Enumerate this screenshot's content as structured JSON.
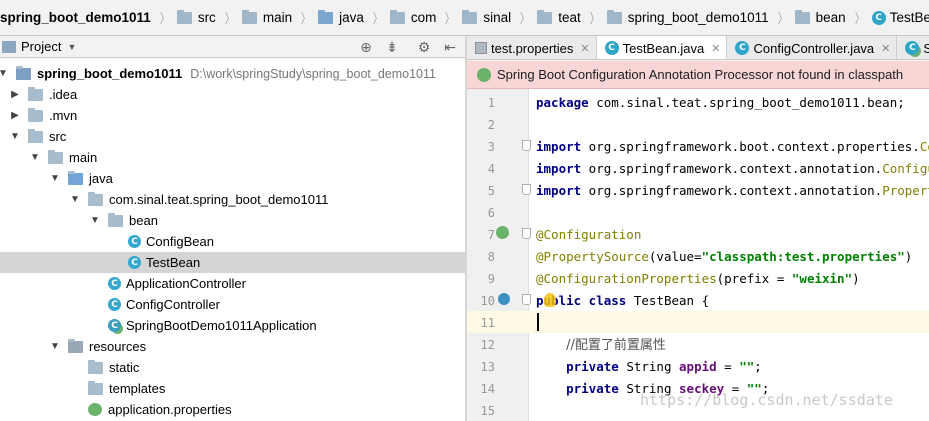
{
  "breadcrumb": [
    {
      "label": "spring_boot_demo1011",
      "icon": "module-folder-icon"
    },
    {
      "label": "src",
      "icon": "folder-icon"
    },
    {
      "label": "main",
      "icon": "folder-icon"
    },
    {
      "label": "java",
      "icon": "source-folder-icon"
    },
    {
      "label": "com",
      "icon": "folder-icon"
    },
    {
      "label": "sinal",
      "icon": "folder-icon"
    },
    {
      "label": "teat",
      "icon": "folder-icon"
    },
    {
      "label": "spring_boot_demo1011",
      "icon": "folder-icon"
    },
    {
      "label": "bean",
      "icon": "folder-icon"
    },
    {
      "label": "TestBean",
      "icon": "class-icon"
    }
  ],
  "project_panel": {
    "title": "Project",
    "tree": [
      {
        "label": "spring_boot_demo1011",
        "path": "D:\\work\\springStudy\\spring_boot_demo1011",
        "depth": 0,
        "toggle": "▼",
        "icon": "module"
      },
      {
        "label": ".idea",
        "depth": 1,
        "toggle": "▶",
        "icon": "folder"
      },
      {
        "label": ".mvn",
        "depth": 1,
        "toggle": "▶",
        "icon": "folder"
      },
      {
        "label": "src",
        "depth": 1,
        "toggle": "▼",
        "icon": "folder"
      },
      {
        "label": "main",
        "depth": 2,
        "toggle": "▼",
        "icon": "folder"
      },
      {
        "label": "java",
        "depth": 3,
        "toggle": "▼",
        "icon": "src"
      },
      {
        "label": "com.sinal.teat.spring_boot_demo1011",
        "depth": 4,
        "toggle": "▼",
        "icon": "folder"
      },
      {
        "label": "bean",
        "depth": 5,
        "toggle": "▼",
        "icon": "folder"
      },
      {
        "label": "ConfigBean",
        "depth": 6,
        "toggle": "",
        "icon": "class"
      },
      {
        "label": "TestBean",
        "depth": 6,
        "toggle": "",
        "icon": "class",
        "selected": true
      },
      {
        "label": "ApplicationController",
        "depth": 5,
        "toggle": "",
        "icon": "class"
      },
      {
        "label": "ConfigController",
        "depth": 5,
        "toggle": "",
        "icon": "class"
      },
      {
        "label": "SpringBootDemo1011Application",
        "depth": 5,
        "toggle": "",
        "icon": "spring-class"
      },
      {
        "label": "resources",
        "depth": 3,
        "toggle": "▼",
        "icon": "res"
      },
      {
        "label": "static",
        "depth": 4,
        "toggle": "",
        "icon": "folder"
      },
      {
        "label": "templates",
        "depth": 4,
        "toggle": "",
        "icon": "folder"
      },
      {
        "label": "application.properties",
        "depth": 4,
        "toggle": "",
        "icon": "properties"
      }
    ]
  },
  "tabs": [
    {
      "label": "test.properties",
      "icon": "properties-file-icon",
      "active": false
    },
    {
      "label": "TestBean.java",
      "icon": "class-icon",
      "active": true
    },
    {
      "label": "ConfigController.java",
      "icon": "class-icon",
      "active": false
    },
    {
      "label": "S",
      "icon": "spring-class-icon",
      "active": false
    }
  ],
  "banner": {
    "text": "Spring Boot Configuration Annotation Processor not found in classpath"
  },
  "editor": {
    "current_line": 11,
    "lines": [
      {
        "n": "1",
        "html": "<span class=\"kw\">package</span> com.sinal.teat.spring_boot_demo1011.bean;"
      },
      {
        "n": "2",
        "html": ""
      },
      {
        "n": "3",
        "html": "<span class=\"kw\">import</span> org.springframework.boot.context.properties.<span class=\"ann\">Confi</span>"
      },
      {
        "n": "4",
        "html": "<span class=\"kw\">import</span> org.springframework.context.annotation.<span class=\"ann\">Configura</span>"
      },
      {
        "n": "5",
        "html": "<span class=\"kw\">import</span> org.springframework.context.annotation.<span class=\"ann\">PropertySo</span>"
      },
      {
        "n": "6",
        "html": ""
      },
      {
        "n": "7",
        "html": "<span class=\"ann\">@Configuration</span>"
      },
      {
        "n": "8",
        "html": "<span class=\"ann\">@PropertySource</span>(value=<span class=\"str\">\"classpath:test.properties\"</span>)"
      },
      {
        "n": "9",
        "html": "<span class=\"ann\">@ConfigurationProperties</span>(prefix = <span class=\"str\">\"weixin\"</span>)"
      },
      {
        "n": "10",
        "html": "<span class=\"kw\">public class</span> TestBean {"
      },
      {
        "n": "11",
        "html": ""
      },
      {
        "n": "12",
        "html": "    <span class=\"cmt\">//配置了前置属性</span>"
      },
      {
        "n": "13",
        "html": "    <span class=\"kw\">private</span> String <span class=\"fld\">appid</span> = <span class=\"str\">\"\"</span>;"
      },
      {
        "n": "14",
        "html": "    <span class=\"kw\">private</span> String <span class=\"fld\">seckey</span> = <span class=\"str\">\"\"</span>;"
      },
      {
        "n": "15",
        "html": ""
      }
    ]
  },
  "watermark": "https://blog.csdn.net/ssdate"
}
